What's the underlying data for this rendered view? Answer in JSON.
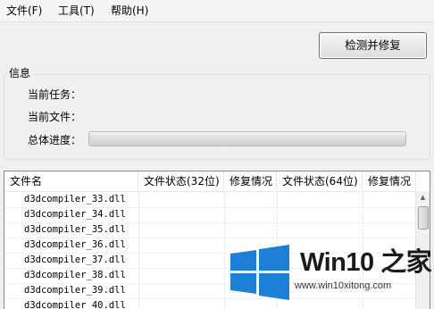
{
  "menubar": {
    "items": [
      {
        "label": "文件(F)"
      },
      {
        "label": "工具(T)"
      },
      {
        "label": "帮助(H)"
      }
    ]
  },
  "toolbar": {
    "fix_label": "检测并修复"
  },
  "info": {
    "title": "信息",
    "task_label": "当前任务：",
    "file_label": "当前文件：",
    "progress_label": "总体进度：",
    "progress_value": 0
  },
  "list": {
    "columns": [
      "文件名",
      "文件状态(32位)",
      "修复情况",
      "文件状态(64位)",
      "修复情况"
    ],
    "rows": [
      {
        "name": "d3dcompiler_33.dll"
      },
      {
        "name": "d3dcompiler_34.dll"
      },
      {
        "name": "d3dcompiler_35.dll"
      },
      {
        "name": "d3dcompiler_36.dll"
      },
      {
        "name": "d3dcompiler_37.dll"
      },
      {
        "name": "d3dcompiler_38.dll"
      },
      {
        "name": "d3dcompiler_39.dll"
      },
      {
        "name": "d3dcompiler_40.dll"
      }
    ]
  },
  "watermark": {
    "brand": "Win10 之家",
    "url": "www.win10xitong.com",
    "logo_icon": "windows-logo-icon",
    "logo_color": "#1e7fd6"
  }
}
